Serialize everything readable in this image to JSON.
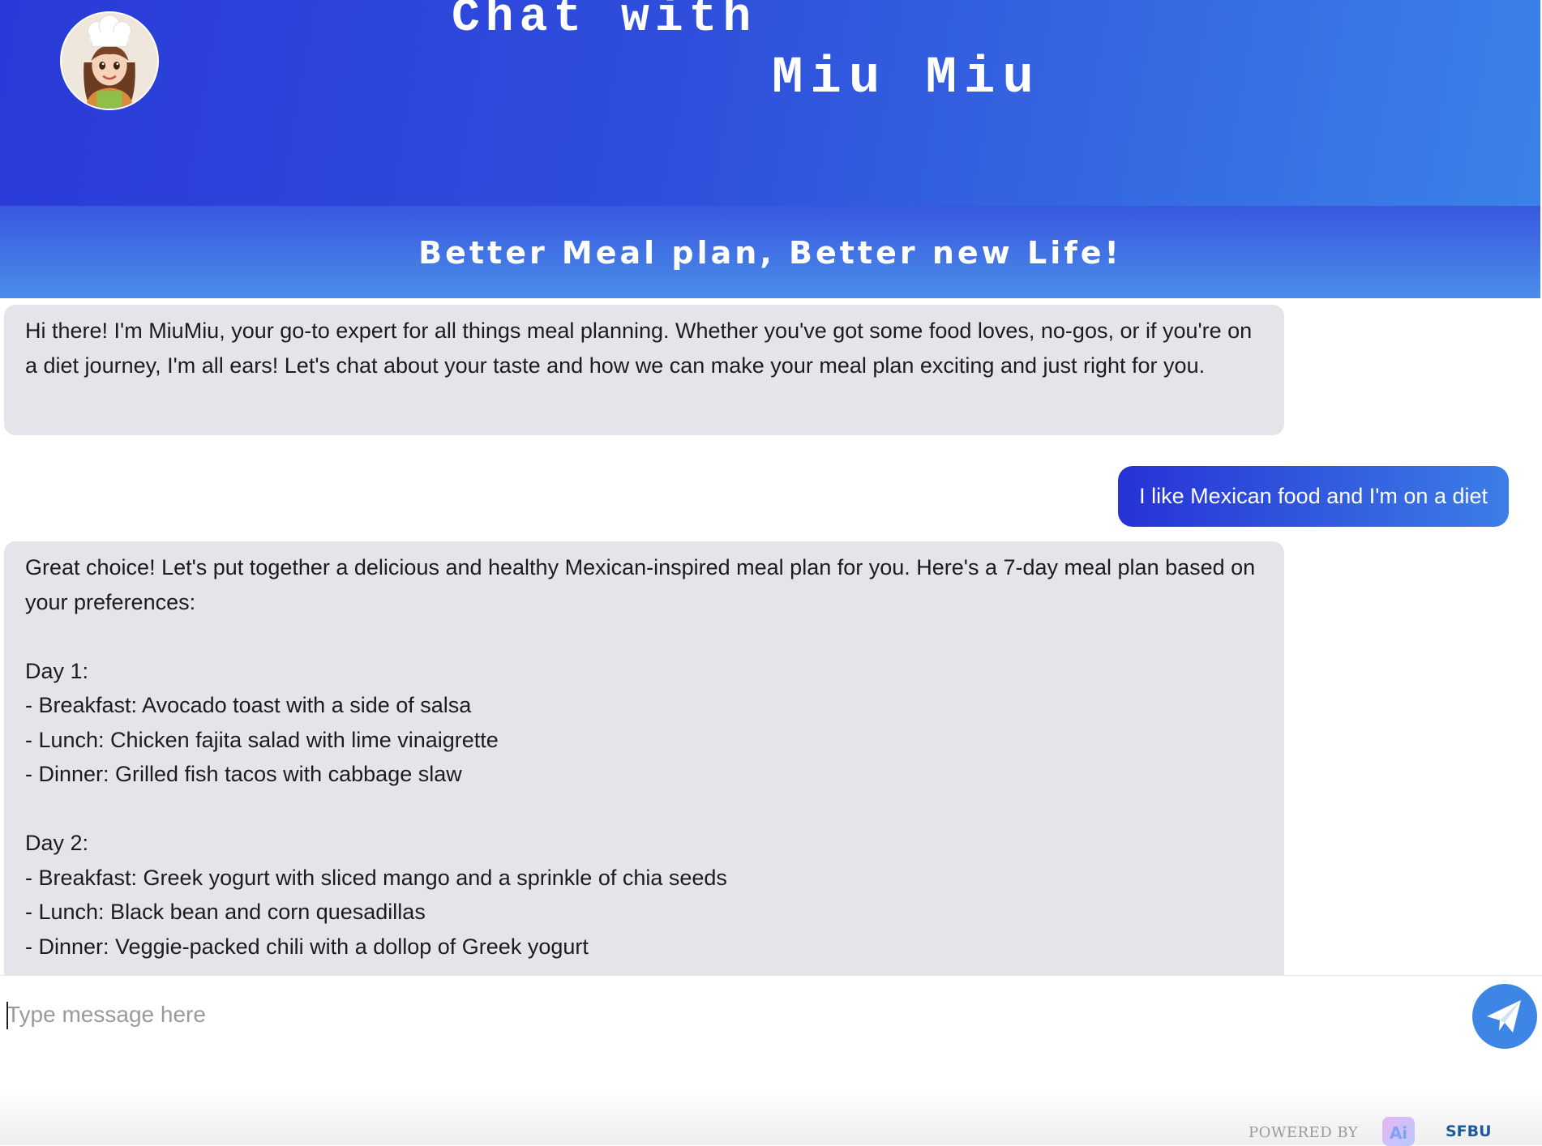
{
  "header": {
    "title_line1": "Chat with",
    "title_line2": "Miu Miu",
    "subtitle": "Better Meal plan, Better new Life!",
    "avatar_icon": "chef-avatar-icon"
  },
  "messages": [
    {
      "role": "bot",
      "text": "Hi there! I'm MiuMiu, your go-to expert for all things meal planning. Whether you've got some food loves, no-gos, or if you're on a diet journey, I'm all ears! Let's chat about your taste and how we can make your meal plan exciting and just right for you."
    },
    {
      "role": "user",
      "text": "I like Mexican food and I'm on a diet"
    },
    {
      "role": "bot",
      "text": "Great choice! Let's put together a delicious and healthy Mexican-inspired meal plan for you. Here's a 7-day meal plan based on your preferences:\n\nDay 1:\n- Breakfast: Avocado toast with a side of salsa\n- Lunch: Chicken fajita salad with lime vinaigrette\n- Dinner: Grilled fish tacos with cabbage slaw\n\nDay 2:\n- Breakfast: Greek yogurt with sliced mango and a sprinkle of chia seeds\n- Lunch: Black bean and corn quesadillas\n- Dinner: Veggie-packed chili with a dollop of Greek yogurt"
    }
  ],
  "input": {
    "placeholder": "Type message here",
    "value": ""
  },
  "send_button": {
    "icon": "paper-plane-send-icon"
  },
  "footer": {
    "powered_by": "POWERED BY",
    "ai_badge": "Ai",
    "brand": "SFBU"
  },
  "colors": {
    "header_gradient_start": "#2a3ad8",
    "header_gradient_end": "#3b82e8",
    "bot_bubble": "#e3e5ea",
    "user_bubble_start": "#2632d5",
    "user_bubble_end": "#3c7ee7",
    "send_button": "#3e86e6"
  }
}
